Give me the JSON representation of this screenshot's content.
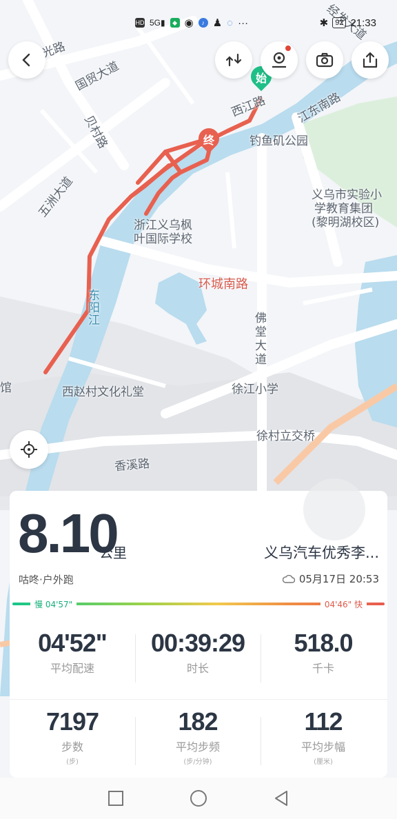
{
  "status_bar": {
    "icons": [
      "HD",
      "5G",
      "signal",
      "wechat-shield",
      "wechat",
      "music",
      "qq",
      "qq-browser",
      "more"
    ],
    "bluetooth": "✱",
    "battery": "92",
    "time": "21:33"
  },
  "map": {
    "labels": {
      "guoguang": "光路",
      "guomao": "国贸大道",
      "beiyuan": "贝村路",
      "wuzhou": "五洲大道",
      "xijiang": "西江路",
      "jiangdong": "江东南路",
      "diaoyu": "钓鱼矶公园",
      "school1_line1": "义乌市实验小",
      "school1_line2": "学教育集团",
      "school1_line3": "(黎明湖校区)",
      "maple_line1": "浙江义乌枫",
      "maple_line2": "叶国际学校",
      "huancheng": "环城南路",
      "dongyang": "东阳江",
      "fotang": "佛堂大道",
      "xijiang_school": "徐江小学",
      "xizhao": "西赵村文化礼堂",
      "xucun": "徐村立交桥",
      "xiangxi": "香溪路",
      "guan": "馆",
      "jingfa": "经发大道"
    },
    "start_marker": "始",
    "end_marker": "终"
  },
  "toolbar": {
    "back_icon": "chevron-left-icon",
    "route_icon": "route-swap-icon",
    "location_pin_icon": "map-pin-user-icon",
    "camera_icon": "camera-icon",
    "share_icon": "share-icon",
    "locate_icon": "locate-crosshair-icon"
  },
  "summary": {
    "distance": "8.10",
    "unit": "公里",
    "route_name": "义乌汽车优秀李...",
    "source": "咕咚·户外跑",
    "date": "05月17日 20:53",
    "pace_slow": "慢 04'57\"",
    "pace_fast": "04'46\" 快"
  },
  "stats_row1": [
    {
      "value": "04'52\"",
      "label": "平均配速"
    },
    {
      "value": "00:39:29",
      "label": "时长"
    },
    {
      "value": "518.0",
      "label": "千卡"
    }
  ],
  "stats_row2": [
    {
      "value": "7197",
      "label": "步数",
      "sub": "(步)"
    },
    {
      "value": "182",
      "label": "平均步频",
      "sub": "(步/分钟)"
    },
    {
      "value": "112",
      "label": "平均步幅",
      "sub": "(厘米)"
    }
  ],
  "colors": {
    "route": "#e8604f",
    "river": "#b9dcee",
    "park": "#dcefdc",
    "start_marker": "#1fbf87"
  },
  "navbar": {
    "recent_icon": "square-icon",
    "home_icon": "circle-icon",
    "back_icon": "triangle-back-icon"
  }
}
